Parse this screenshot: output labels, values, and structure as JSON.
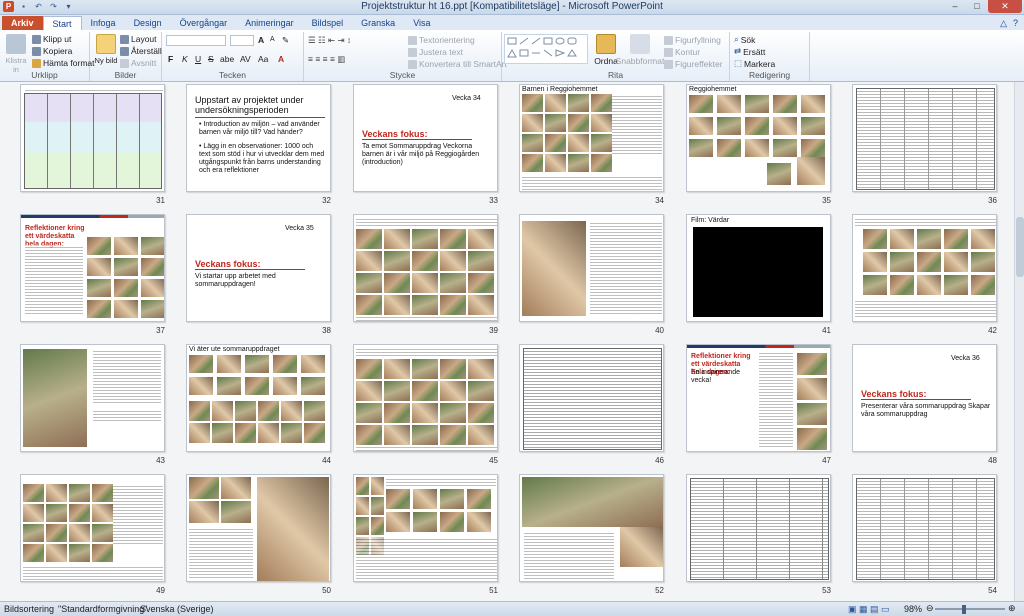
{
  "window": {
    "title": "Projektstruktur  ht 16.ppt [Kompatibilitetsläge] - Microsoft PowerPoint",
    "controls": [
      "–",
      "□",
      "✕"
    ]
  },
  "tabs": [
    {
      "label": "Arkiv"
    },
    {
      "label": "Start"
    },
    {
      "label": "Infoga"
    },
    {
      "label": "Design"
    },
    {
      "label": "Övergångar"
    },
    {
      "label": "Animeringar"
    },
    {
      "label": "Bildspel"
    },
    {
      "label": "Granska"
    },
    {
      "label": "Visa"
    }
  ],
  "ribbon": {
    "clipboard": {
      "paste": "Klistra in",
      "cut": "Klipp ut",
      "copy": "Kopiera",
      "format_painter": "Hämta format",
      "group": "Urklipp"
    },
    "slides": {
      "new_slide": "Ny bild",
      "layout": "Layout",
      "reset": "Återställ",
      "section": "Avsnitt",
      "group": "Bilder"
    },
    "font": {
      "group": "Tecken",
      "bold": "F",
      "italic": "K",
      "underline": "U",
      "strike": "S",
      "shadow": "abe",
      "aa": "Aa",
      "grow": "A",
      "shrink": "A"
    },
    "paragraph": {
      "text_direction": "Textorientering",
      "align_text": "Justera text",
      "smartart": "Konvertera till SmartArt",
      "group": "Stycke"
    },
    "drawing": {
      "arrange": "Ordna",
      "quick_styles": "Snabbformat",
      "fill": "Figurfyllning",
      "outline": "Kontur",
      "effects": "Figureffekter",
      "group": "Rita"
    },
    "editing": {
      "find": "Sök",
      "replace": "Ersätt",
      "select": "Markera",
      "group": "Redigering"
    }
  },
  "slides": [
    {
      "n": "31",
      "kind": "table-color"
    },
    {
      "n": "32",
      "kind": "text",
      "title": "Uppstart av projektet under undersökningsperioden",
      "bullets": [
        "Introduction av miljön – vad använder barnen vår miljö till? Vad händer?",
        "Lägg in en observationer: 1000 och text som stöd i hur vi utvecklar dem med utgångspunkt från barns understanding och era reflektioner"
      ]
    },
    {
      "n": "33",
      "kind": "week",
      "week": "Vecka 34",
      "heading": "Veckans fokus:",
      "body": "Ta emot Sommaruppdrag\nVeckorna barnen är i vår miljö på Reggiogården (introduction)"
    },
    {
      "n": "34",
      "kind": "photos-text",
      "heading": "Barnen i Reggiohemmet"
    },
    {
      "n": "35",
      "kind": "photos",
      "heading": "Reggiohemmet"
    },
    {
      "n": "36",
      "kind": "table"
    },
    {
      "n": "37",
      "kind": "reflection",
      "heading": "Reflektioner kring ett värdeskatta hela dagen:"
    },
    {
      "n": "38",
      "kind": "week",
      "week": "Vecka 35",
      "heading": "Veckans fokus:",
      "body": "Vi startar upp arbetet med sommaruppdragen!"
    },
    {
      "n": "39",
      "kind": "photos-dense"
    },
    {
      "n": "40",
      "kind": "photo-text"
    },
    {
      "n": "41",
      "kind": "black",
      "heading": "Film: Värdar"
    },
    {
      "n": "42",
      "kind": "photos-text2"
    },
    {
      "n": "43",
      "kind": "photo-list"
    },
    {
      "n": "44",
      "kind": "photos-grid",
      "heading": "Vi äter ute sommaruppdraget"
    },
    {
      "n": "45",
      "kind": "photos-dense"
    },
    {
      "n": "46",
      "kind": "table2"
    },
    {
      "n": "47",
      "kind": "reflection2",
      "heading": "Reflektioner kring ett värdeskatta hela dagen:",
      "sub": "En inspirerande vecka!"
    },
    {
      "n": "48",
      "kind": "week",
      "week": "Vecka 36",
      "heading": "Veckans fokus:",
      "body": "Presenterar våra sommaruppdrag\nSkapar våra sommaruppdrag"
    },
    {
      "n": "49",
      "kind": "photos-text"
    },
    {
      "n": "50",
      "kind": "photo-large"
    },
    {
      "n": "51",
      "kind": "photos-text3"
    },
    {
      "n": "52",
      "kind": "photo-list2"
    },
    {
      "n": "53",
      "kind": "table3"
    },
    {
      "n": "54",
      "kind": "table"
    }
  ],
  "status": {
    "view": "Bildsortering",
    "theme": "\"Standardformgivning\"",
    "language": "Svenska (Sverige)",
    "zoom": "98%"
  },
  "colors": {
    "accent_red": "#c0271e",
    "file_tab": "#c8502e",
    "ribbon_text": "#15428b"
  }
}
